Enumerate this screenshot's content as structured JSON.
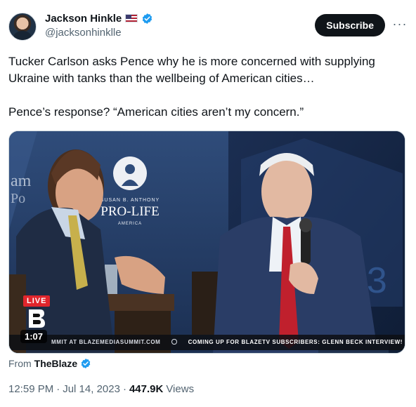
{
  "author": {
    "display_name": "Jackson Hinkle",
    "handle": "@jacksonhinklle",
    "flag_icon": "us-flag-icon",
    "verified_icon": "verified-badge-icon"
  },
  "header": {
    "subscribe_label": "Subscribe",
    "more_icon": "more-icon"
  },
  "tweet": {
    "paragraph_1": "Tucker Carlson asks Pence why he is more concerned with supplying Ukraine with tanks than the wellbeing of American cities…",
    "paragraph_2": "Pence’s response? “American cities aren’t my concern.”"
  },
  "media": {
    "live_label": "LIVE",
    "duration": "1:07",
    "backdrop_org": "SUSAN B. ANTHONY",
    "backdrop_title": "PRO-LIFE",
    "backdrop_sub": "AMERICA",
    "ticker_left": "MMIT AT BLAZEMEDIASUMMIT.COM",
    "ticker_right": "COMING UP FOR BLAZETV SUBSCRIBERS: GLENN BECK INTERVIEW!"
  },
  "source": {
    "from_label": "From",
    "name": "TheBlaze"
  },
  "meta": {
    "time": "12:59 PM",
    "separator": "·",
    "date": "Jul 14, 2023",
    "views_count": "447.9K",
    "views_label": "Views"
  },
  "colors": {
    "verified_blue": "#1d9bf0",
    "live_red": "#e0252c",
    "text_secondary": "#536471"
  }
}
